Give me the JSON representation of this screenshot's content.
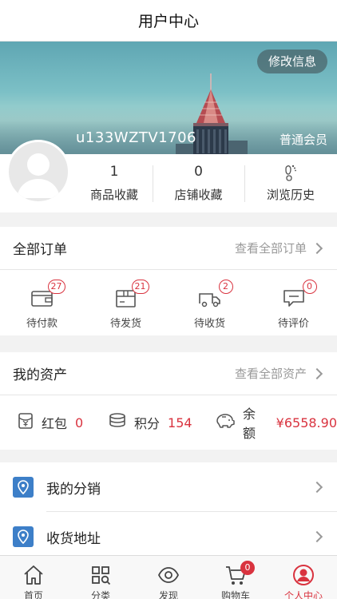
{
  "header": {
    "title": "用户中心"
  },
  "profile": {
    "edit_label": "修改信息",
    "username": "u133WZTV1706",
    "member_level": "普通会员"
  },
  "stats": [
    {
      "value": "1",
      "label": "商品收藏"
    },
    {
      "value": "0",
      "label": "店铺收藏"
    },
    {
      "value": "",
      "label": "浏览历史",
      "icon": "footprint-icon"
    }
  ],
  "orders": {
    "title": "全部订单",
    "more": "查看全部订单",
    "items": [
      {
        "label": "待付款",
        "count": "27",
        "icon": "wallet-icon"
      },
      {
        "label": "待发货",
        "count": "21",
        "icon": "box-icon"
      },
      {
        "label": "待收货",
        "count": "2",
        "icon": "truck-icon"
      },
      {
        "label": "待评价",
        "count": "0",
        "icon": "comment-icon"
      }
    ]
  },
  "assets": {
    "title": "我的资产",
    "more": "查看全部资产",
    "items": [
      {
        "label": "红包",
        "value": "0",
        "icon": "red-packet-icon"
      },
      {
        "label": "积分",
        "value": "154",
        "icon": "coins-icon"
      },
      {
        "label": "余额",
        "value": "¥6558.90",
        "icon": "piggy-bank-icon"
      }
    ]
  },
  "menu": [
    {
      "label": "我的分销",
      "icon": "location-pin-icon"
    },
    {
      "label": "收货地址",
      "icon": "location-pin-icon"
    }
  ],
  "tabbar": {
    "items": [
      {
        "label": "首页",
        "icon": "home-icon"
      },
      {
        "label": "分类",
        "icon": "category-icon"
      },
      {
        "label": "发现",
        "icon": "eye-icon"
      },
      {
        "label": "购物车",
        "icon": "cart-icon",
        "badge": "0"
      },
      {
        "label": "个人中心",
        "icon": "user-icon",
        "active": true
      }
    ]
  },
  "colors": {
    "accent": "#d9333f",
    "pin_blue": "#3d7fc8"
  }
}
